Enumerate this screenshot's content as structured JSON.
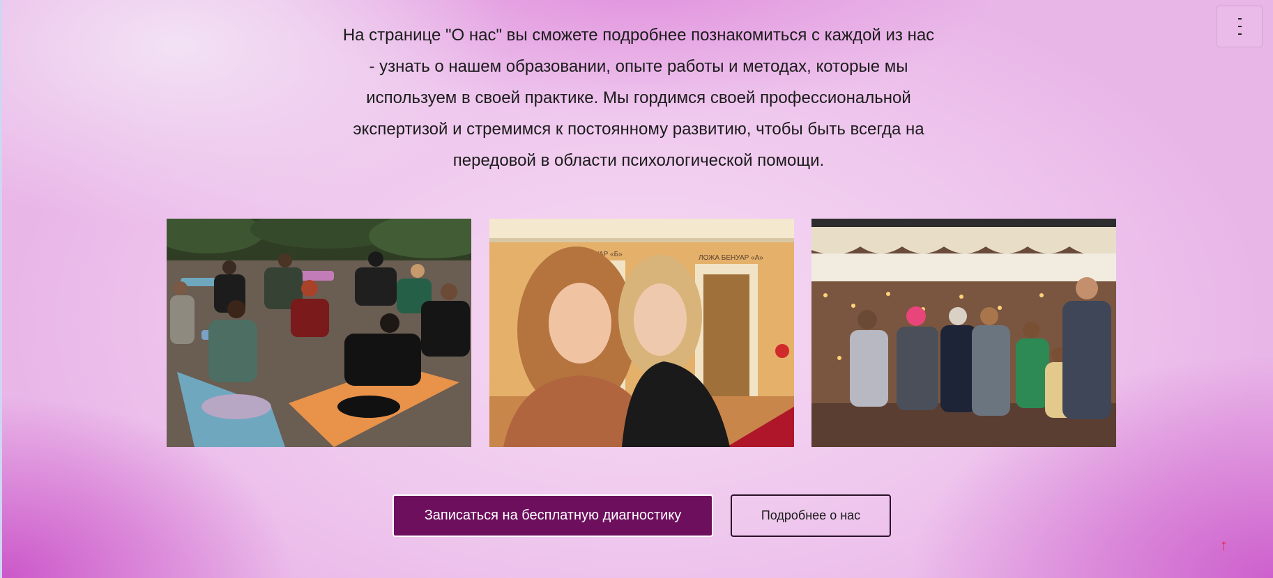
{
  "intro": {
    "text": "На странице \"О нас\" вы сможете подробнее познакомиться с каждой из нас - узнать о нашем образовании, опыте работы и методах, которые мы используем в своей практике. Мы гордимся своей профессиональной экспертизой и стремимся к постоянному развитию, чтобы быть всегда на передовой в области психологической помощи."
  },
  "header": {
    "menu_icon": "vertical-menu-icon"
  },
  "gallery": {
    "photos": [
      {
        "icon": "group-session-photo"
      },
      {
        "icon": "selfie-photo",
        "sign_left": "ЛОЖА БЕНУАР «Б»",
        "sign_right": "ЛОЖА БЕНУАР «А»"
      },
      {
        "icon": "group-photo"
      }
    ]
  },
  "actions": {
    "primary_label": "Записаться на бесплатную диагностику",
    "secondary_label": "Подробнее о нас"
  },
  "scroll_top": {
    "label": "↑",
    "icon": "arrow-up-icon"
  },
  "colors": {
    "primary_button": "#6e0f5e",
    "scroll_arrow": "#e8264a"
  }
}
